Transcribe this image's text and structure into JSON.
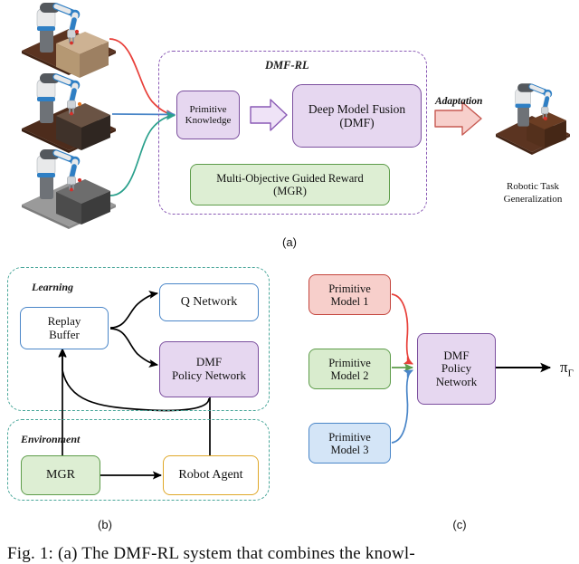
{
  "figure": {
    "caption": "Fig. 1: (a) The DMF-RL system that combines the knowl-",
    "subfigure_labels": [
      "(a)",
      "(b)",
      "(c)"
    ]
  },
  "panel_a": {
    "container_label": "DMF-RL",
    "nodes": {
      "primitive_knowledge": {
        "line1": "Primitive",
        "line2": "Knowledge",
        "fill": "#e6d7f0",
        "stroke": "#7b4f9e"
      },
      "deep_model_fusion": {
        "line1": "Deep Model Fusion",
        "line2": "(DMF)",
        "fill": "#e6d7f0",
        "stroke": "#7b4f9e"
      },
      "mgr": {
        "line1": "Multi-Objective Guided Reward",
        "line2": "(MGR)",
        "fill": "#ddeed3",
        "stroke": "#5d9c4a"
      }
    },
    "adaptation_label": "Adaptation",
    "output_caption": {
      "line1": "Robotic Task",
      "line2": "Generalization"
    },
    "inputs": [
      {
        "name": "wooden-box-task",
        "curve_color": "#e8403a"
      },
      {
        "name": "dark-box-task",
        "curve_color": "#4a86c8"
      },
      {
        "name": "grey-box-task",
        "curve_color": "#2aa08c"
      }
    ],
    "colors": {
      "container_border": "#8a5ab5",
      "adaptation_arrow_fill": "#f7cfcb",
      "adaptation_arrow_stroke": "#c75a52",
      "fusion_arrow_fill": "#efe3f7",
      "fusion_arrow_stroke": "#8a5ab5"
    }
  },
  "panel_b": {
    "learning_label": "Learning",
    "environment_label": "Environment",
    "nodes": {
      "replay_buffer": {
        "line1": "Replay",
        "line2": "Buffer",
        "fill": "#ffffff",
        "stroke": "#4a86c8"
      },
      "q_network": {
        "line1": "Q Network",
        "line2": "",
        "fill": "#ffffff",
        "stroke": "#4a86c8"
      },
      "dmf_policy_network": {
        "line1": "DMF",
        "line2": "Policy Network",
        "fill": "#e6d7f0",
        "stroke": "#7b4f9e"
      },
      "mgr": {
        "line1": "MGR",
        "line2": "",
        "fill": "#ddeed3",
        "stroke": "#5d9c4a"
      },
      "robot_agent": {
        "line1": "Robot Agent",
        "line2": "",
        "fill": "#ffffff",
        "stroke": "#e0a829"
      }
    },
    "colors": {
      "panel_border": "#4aa79a",
      "arrow": "#000000"
    }
  },
  "panel_c": {
    "nodes": {
      "primitive_model_1": {
        "line1": "Primitive",
        "line2": "Model 1",
        "fill": "#f7cfcb",
        "stroke": "#c4453d"
      },
      "primitive_model_2": {
        "line1": "Primitive",
        "line2": "Model 2",
        "fill": "#d9ecce",
        "stroke": "#5d9c4a"
      },
      "primitive_model_3": {
        "line1": "Primitive",
        "line2": "Model 3",
        "fill": "#d4e5f7",
        "stroke": "#4a86c8"
      },
      "dmf_policy_network": {
        "line1": "DMF",
        "line2": "Policy",
        "line3": "Network",
        "fill": "#e6d7f0",
        "stroke": "#7b4f9e"
      }
    },
    "output_symbol": "π",
    "output_subscript": "Γ",
    "connector_colors": {
      "model_1": "#e8403a",
      "model_2": "#5d9c4a",
      "model_3": "#4a86c8",
      "output": "#000000"
    }
  }
}
